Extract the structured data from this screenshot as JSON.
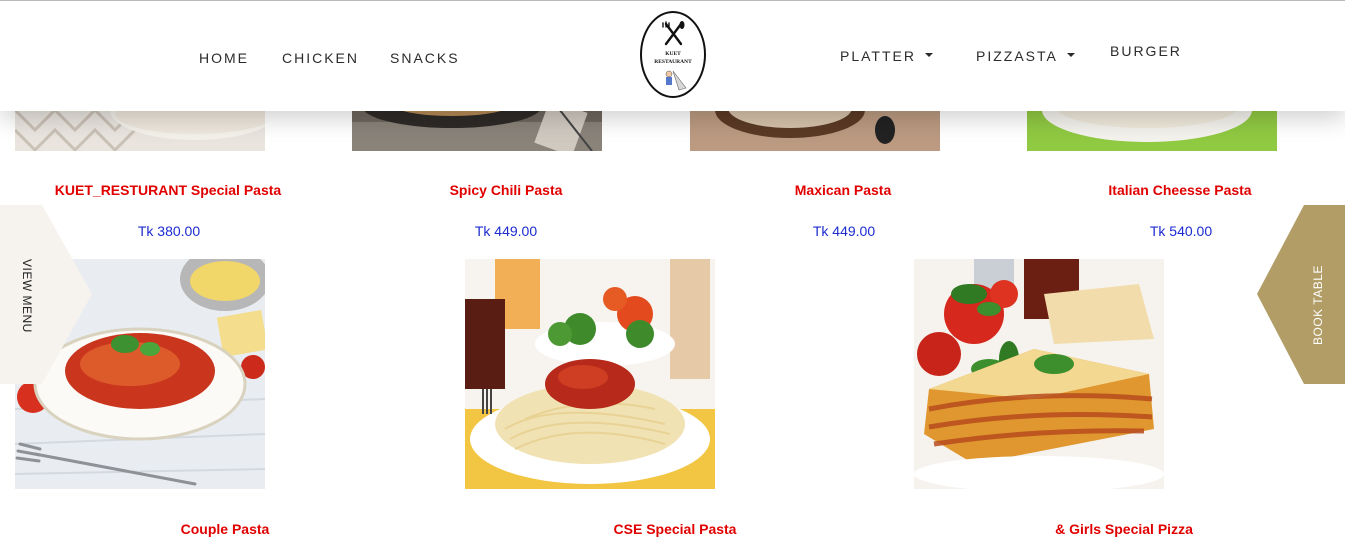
{
  "nav": {
    "left_links": [
      "HOME",
      "CHICKEN",
      "SNACKS"
    ],
    "right_links": [
      {
        "label": "PLATTER",
        "dropdown": true
      },
      {
        "label": "PIZZASTA",
        "dropdown": true
      },
      {
        "label": "BURGER",
        "dropdown": false
      }
    ],
    "logo": {
      "line1": "KUET",
      "line2": "RESTAURANT",
      "icon": "fork-knife-icon"
    }
  },
  "menu_row_1": [
    {
      "name": "KUET_RESTURANT Special Pasta",
      "price": "Tk 380.00"
    },
    {
      "name": "Spicy Chili Pasta",
      "price": "Tk 449.00"
    },
    {
      "name": "Maxican Pasta",
      "price": "Tk 449.00"
    },
    {
      "name": "Italian Cheesse Pasta",
      "price": "Tk 540.00"
    }
  ],
  "menu_row_2": [
    {
      "name": "Couple Pasta"
    },
    {
      "name": "CSE Special Pasta"
    },
    {
      "name": "& Girls Special Pizza"
    }
  ],
  "side_tabs": {
    "left": "VIEW MENU",
    "right": "BOOK TABLE"
  },
  "colors": {
    "dish_name": "#e10000",
    "price": "#1c2bd0",
    "book_tab": "#b19d65",
    "menu_tab": "#f6f3ef"
  }
}
